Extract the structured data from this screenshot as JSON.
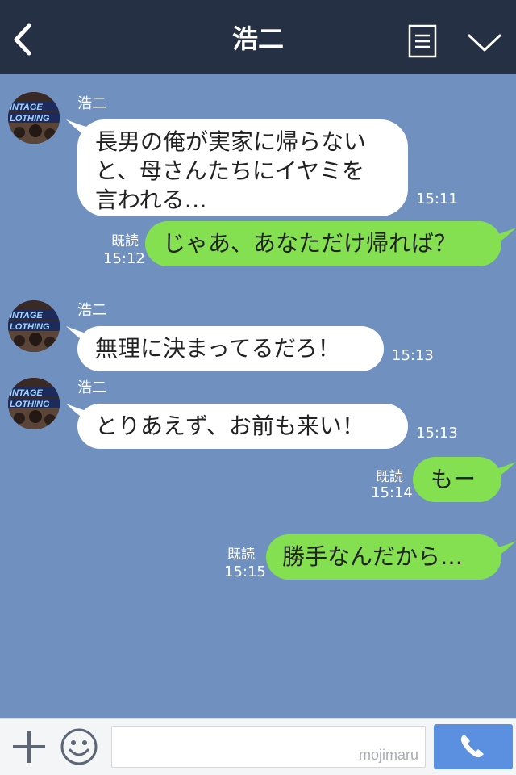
{
  "header": {
    "title": "浩二",
    "back_icon": "chevron-left-icon",
    "menu_icon": "menu-list-icon",
    "collapse_icon": "chevron-down-icon",
    "background": "#263044"
  },
  "chat": {
    "background": "#7090c0",
    "incoming_bubble_color": "#ffffff",
    "outgoing_bubble_color": "#84e050",
    "messages": [
      {
        "direction": "incoming",
        "sender": "浩二",
        "text": "長男の俺が実家に帰らない\nと、母さんたちにイヤミを\n言われる…",
        "time": "15:11"
      },
      {
        "direction": "outgoing",
        "read": "既読",
        "text": "じゃあ、あなただけ帰れば？",
        "time": "15:12"
      },
      {
        "direction": "incoming",
        "sender": "浩二",
        "text": "無理に決まってるだろ！",
        "time": "15:13"
      },
      {
        "direction": "incoming",
        "sender": "浩二",
        "text": "とりあえず、お前も来い！",
        "time": "15:13"
      },
      {
        "direction": "outgoing",
        "read": "既読",
        "text": "もー",
        "time": "15:14"
      },
      {
        "direction": "outgoing",
        "read": "既読",
        "text": "勝手なんだから…",
        "time": "15:15"
      }
    ]
  },
  "footer": {
    "plus_icon": "plus-icon",
    "emoji_icon": "smiley-icon",
    "input_value": "",
    "watermark": "mojimaru",
    "call_icon": "phone-icon",
    "call_button_color": "#5b8fdf"
  }
}
